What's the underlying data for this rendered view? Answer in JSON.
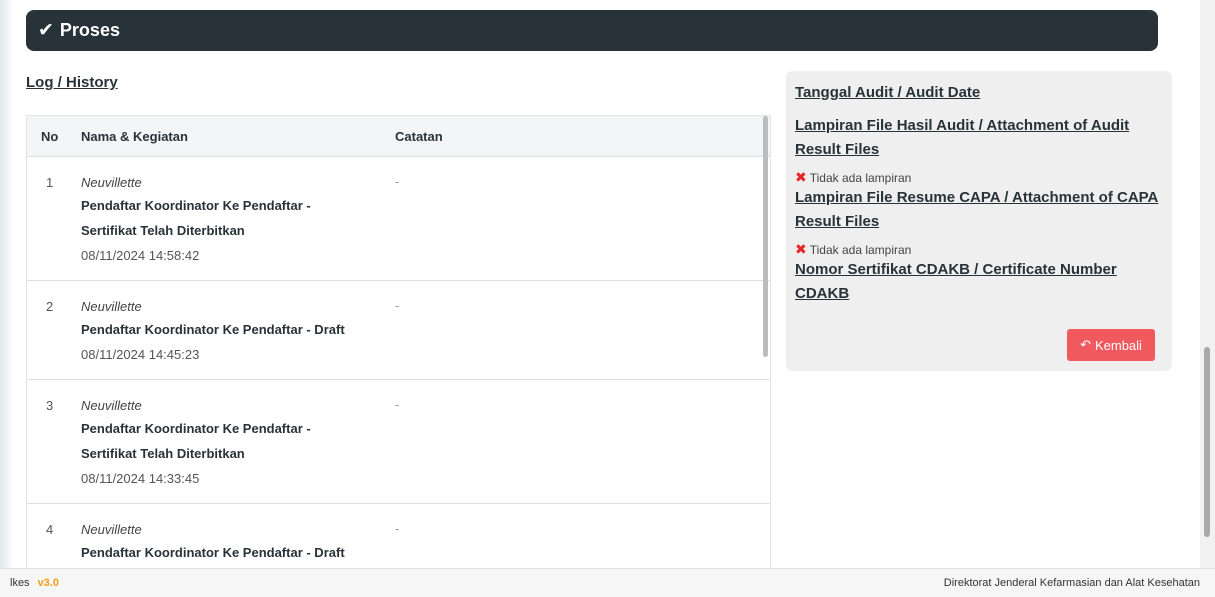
{
  "header": {
    "title": "Proses"
  },
  "log": {
    "title": "Log / History",
    "columns": [
      "No",
      "Nama & Kegiatan",
      "Catatan"
    ],
    "rows": [
      {
        "no": "1",
        "actor": "Neuvillette",
        "activity_line1": "Pendaftar Koordinator Ke Pendaftar -",
        "activity_line2": "Sertifikat Telah Diterbitkan",
        "timestamp": "08/11/2024 14:58:42",
        "note": "-"
      },
      {
        "no": "2",
        "actor": "Neuvillette",
        "activity_line1": "Pendaftar Koordinator Ke Pendaftar - Draft",
        "activity_line2": "",
        "timestamp": "08/11/2024 14:45:23",
        "note": "-"
      },
      {
        "no": "3",
        "actor": "Neuvillette",
        "activity_line1": "Pendaftar Koordinator Ke Pendaftar -",
        "activity_line2": "Sertifikat Telah Diterbitkan",
        "timestamp": "08/11/2024 14:33:45",
        "note": "-"
      },
      {
        "no": "4",
        "actor": "Neuvillette",
        "activity_line1": "Pendaftar Koordinator Ke Pendaftar - Draft",
        "activity_line2": "",
        "timestamp": "",
        "note": "-"
      }
    ]
  },
  "side": {
    "audit_date": "Tanggal Audit / Audit Date",
    "audit_files": "Lampiran File Hasil Audit / Attachment of Audit Result Files",
    "audit_files_status": "Tidak ada lampiran",
    "capa_files": "Lampiran File Resume CAPA / Attachment of CAPA Result Files",
    "capa_files_status": "Tidak ada lampiran",
    "cert_number": "Nomor Sertifikat CDAKB / Certificate Number CDAKB",
    "back_label": "Kembali"
  },
  "footer": {
    "left_text": "lkes",
    "version": "v3.0",
    "right_text": "Direktorat Jenderal Kefarmasian dan Alat Kesehatan"
  },
  "colors": {
    "header_bg": "#283339",
    "back_button": "#f0595d",
    "no_attachment_icon": "#e8242b",
    "version": "#f39c12"
  }
}
